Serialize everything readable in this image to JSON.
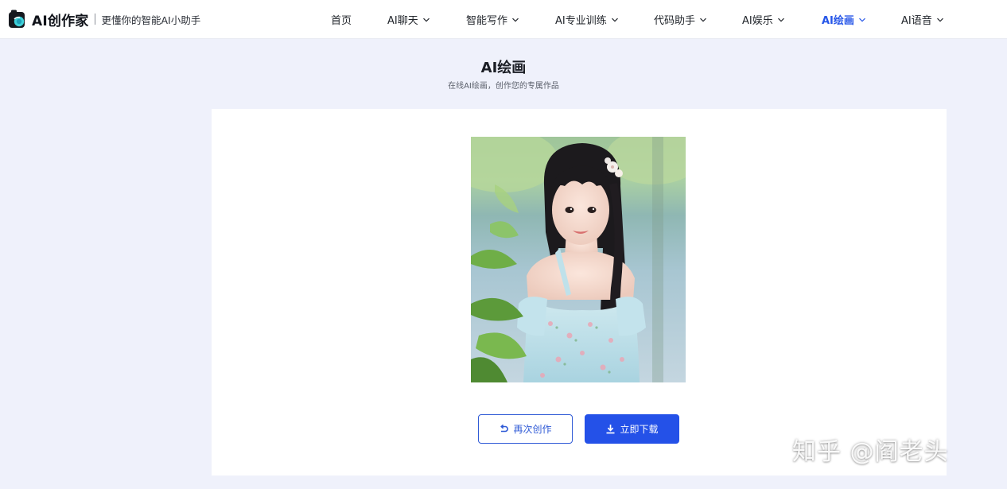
{
  "brand": {
    "name": "AI创作家",
    "slogan": "更懂你的智能AI小助手",
    "accent": "#2656e8"
  },
  "nav": {
    "items": [
      {
        "label": "首页",
        "has_dropdown": false,
        "active": false
      },
      {
        "label": "AI聊天",
        "has_dropdown": true,
        "active": false
      },
      {
        "label": "智能写作",
        "has_dropdown": true,
        "active": false
      },
      {
        "label": "AI专业训练",
        "has_dropdown": true,
        "active": false
      },
      {
        "label": "代码助手",
        "has_dropdown": true,
        "active": false
      },
      {
        "label": "AI娱乐",
        "has_dropdown": true,
        "active": false
      },
      {
        "label": "AI绘画",
        "has_dropdown": true,
        "active": true
      },
      {
        "label": "AI语音",
        "has_dropdown": true,
        "active": false
      }
    ],
    "dropdown_icon": "chevron-down-icon"
  },
  "page": {
    "title": "AI绘画",
    "subtitle": "在线AI绘画，创作您的专属作品"
  },
  "result": {
    "image_subject": "generated portrait of a young woman in a light blue floral dress with flowers in her dark hair, green foliage background"
  },
  "actions": {
    "retry_label": "再次创作",
    "retry_icon": "undo-arrow-icon",
    "download_label": "立即下载",
    "download_icon": "download-icon"
  },
  "watermark": {
    "text": "知乎 @阎老头"
  }
}
